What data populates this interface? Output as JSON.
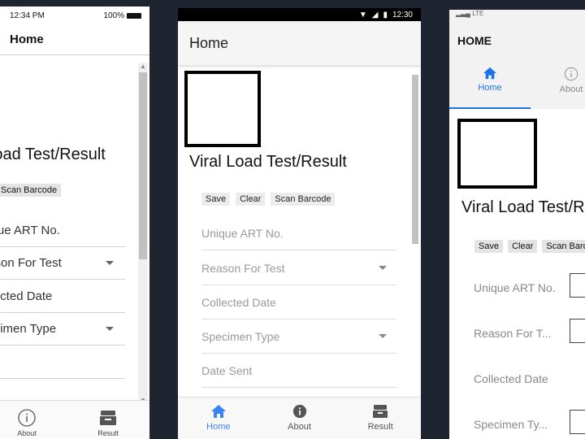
{
  "phone1": {
    "status": {
      "time": "12:34 PM",
      "battery": "100%"
    },
    "appbar_title": "Home",
    "page_title": "Viral Load Test/Result",
    "buttons": {
      "scan": "Scan Barcode"
    },
    "fields": [
      {
        "label": "Unique ART No.",
        "dropdown": false
      },
      {
        "label": "Reason For Test",
        "dropdown": true
      },
      {
        "label": "Collected Date",
        "dropdown": false
      },
      {
        "label": "Specimen Type",
        "dropdown": true
      },
      {
        "label": "",
        "dropdown": false
      }
    ],
    "tabs": {
      "about": "About",
      "result": "Result"
    }
  },
  "phone2": {
    "status": {
      "time": "12:30"
    },
    "appbar_title": "Home",
    "page_title": "Viral Load Test/Result",
    "buttons": {
      "save": "Save",
      "clear": "Clear",
      "scan": "Scan Barcode"
    },
    "fields": [
      {
        "label": "Unique ART No.",
        "dropdown": false
      },
      {
        "label": "Reason For Test",
        "dropdown": true
      },
      {
        "label": "Collected Date",
        "dropdown": false
      },
      {
        "label": "Specimen Type",
        "dropdown": true
      },
      {
        "label": "Date Sent",
        "dropdown": false
      }
    ],
    "tabs": {
      "home": "Home",
      "about": "About",
      "result": "Result"
    },
    "accent": "#3b82f6"
  },
  "phone3": {
    "status": {
      "carrier": "LTE"
    },
    "appbar_title": "HOME",
    "tabs": {
      "home": "Home",
      "about": "About"
    },
    "page_title": "Viral Load Test/Result",
    "buttons": {
      "save": "Save",
      "clear": "Clear",
      "scan": "Scan Barcode"
    },
    "fields": [
      {
        "label": "Unique ART No."
      },
      {
        "label": "Reason For T..."
      },
      {
        "label": "Collected Date"
      },
      {
        "label": "Specimen Ty..."
      }
    ],
    "accent": "#1a73e8"
  }
}
